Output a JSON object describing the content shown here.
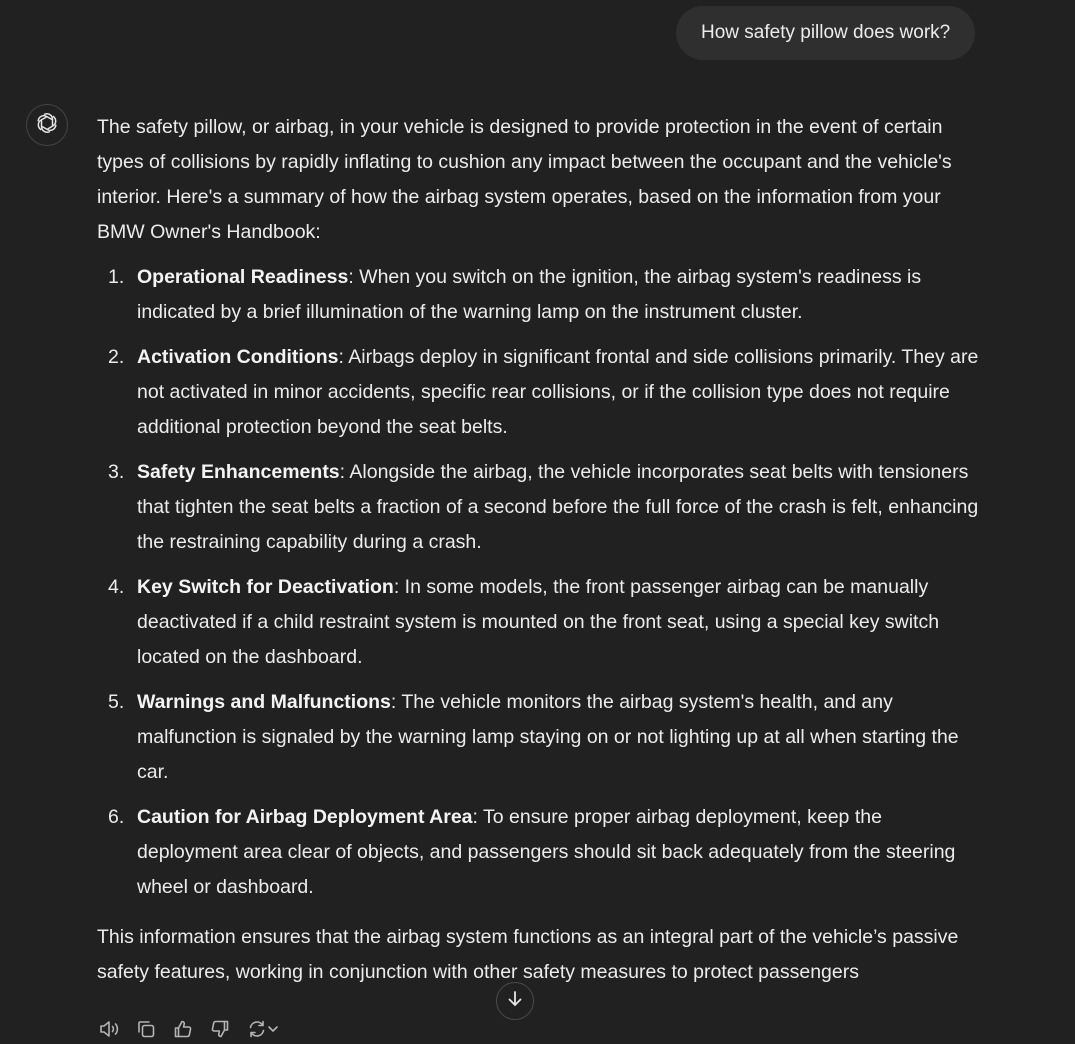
{
  "user_message": "How safety pillow does work?",
  "assistant": {
    "intro": "The safety pillow, or airbag, in your vehicle is designed to provide protection in the event of certain types of collisions by rapidly inflating to cushion any impact between the occupant and the vehicle's interior. Here's a summary of how the airbag system operates, based on the information from your BMW Owner's Handbook:",
    "items": [
      {
        "num": "1.",
        "title": "Operational Readiness",
        "text": ": When you switch on the ignition, the airbag system's readiness is indicated by a brief illumination of the warning lamp on the instrument cluster."
      },
      {
        "num": "2.",
        "title": "Activation Conditions",
        "text": ": Airbags deploy in significant frontal and side collisions primarily. They are not activated in minor accidents, specific rear collisions, or if the collision type does not require additional protection beyond the seat belts."
      },
      {
        "num": "3.",
        "title": "Safety Enhancements",
        "text": ": Alongside the airbag, the vehicle incorporates seat belts with tensioners that tighten the seat belts a fraction of a second before the full force of the crash is felt, enhancing the restraining capability during a crash."
      },
      {
        "num": "4.",
        "title": "Key Switch for Deactivation",
        "text": ": In some models, the front passenger airbag can be manually deactivated if a child restraint system is mounted on the front seat, using a special key switch located on the dashboard."
      },
      {
        "num": "5.",
        "title": "Warnings and Malfunctions",
        "text": ": The vehicle monitors the airbag system's health, and any malfunction is signaled by the warning lamp staying on or not lighting up at all when starting the car."
      },
      {
        "num": "6.",
        "title": "Caution for Airbag Deployment Area",
        "text": ": To ensure proper airbag deployment, keep the deployment area clear of objects, and passengers should sit back adequately from the steering wheel or dashboard."
      }
    ],
    "outro": "This information ensures that the airbag system functions as an integral part of the vehicle’s passive safety features, working in conjunction with other safety measures to protect passengers"
  },
  "icons": {
    "avatar": "openai-logo-icon",
    "scroll": "arrow-down-icon",
    "actions": [
      "read-aloud-icon",
      "copy-icon",
      "thumbs-up-icon",
      "thumbs-down-icon",
      "regenerate-icon",
      "chevron-down-icon"
    ]
  },
  "colors": {
    "background": "#212121",
    "user_bubble": "#2f2f2f",
    "text": "#ececec",
    "icon": "#b4b4b4"
  }
}
